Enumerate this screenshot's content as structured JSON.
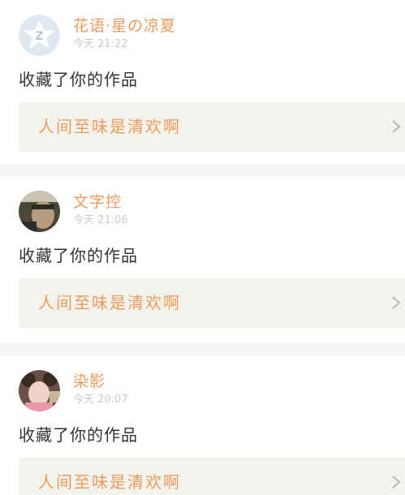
{
  "feed": {
    "items": [
      {
        "username": "花语·星の凉夏",
        "time": "今天 21:22",
        "action": "收藏了你的作品",
        "work_title": "人间至味是清欢啊",
        "avatar_icon": "qzone-default-avatar-icon"
      },
      {
        "username": "文字控",
        "time": "今天 21:06",
        "action": "收藏了你的作品",
        "work_title": "人间至味是清欢啊",
        "avatar_icon": "user-photo-avatar"
      },
      {
        "username": "染影",
        "time": "今天 20:07",
        "action": "收藏了你的作品",
        "work_title": "人间至味是清欢啊",
        "avatar_icon": "user-photo-avatar"
      }
    ]
  },
  "colors": {
    "accent": "#ef9a5a",
    "time_text": "#c9c9c9",
    "body_text": "#333333",
    "link_bg": "#f3f3ee",
    "separator": "#f4f4f4"
  }
}
